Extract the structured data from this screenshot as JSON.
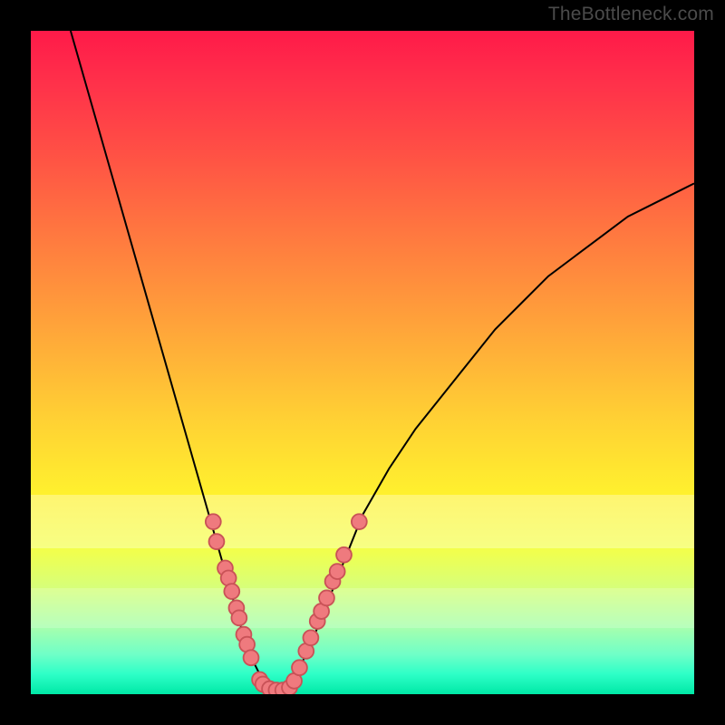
{
  "watermark": "TheBottleneck.com",
  "colors": {
    "frame_bg": "#000000",
    "curve": "#000000",
    "marker_fill": "#ef7a7e",
    "marker_stroke": "#c95257",
    "gradient_top": "#ff1a49",
    "gradient_bottom": "#00e8a6"
  },
  "chart_data": {
    "type": "line",
    "title": "",
    "xlabel": "",
    "ylabel": "",
    "xlim": [
      0,
      100
    ],
    "ylim": [
      0,
      100
    ],
    "grid": false,
    "legend": false,
    "series": [
      {
        "name": "bottleneck-curve",
        "x": [
          6,
          8,
          10,
          12,
          14,
          16,
          18,
          20,
          22,
          24,
          26,
          28,
          30,
          32,
          33,
          34,
          35,
          36,
          37,
          38,
          39,
          40,
          42,
          44,
          46,
          48,
          50,
          54,
          58,
          62,
          66,
          70,
          74,
          78,
          82,
          86,
          90,
          94,
          98,
          100
        ],
        "y": [
          100,
          93,
          86,
          79,
          72,
          65,
          58,
          51,
          44,
          37,
          30,
          23,
          16,
          9,
          6,
          4,
          2,
          1,
          0.5,
          0.5,
          1,
          3,
          7,
          12,
          17,
          22,
          27,
          34,
          40,
          45,
          50,
          55,
          59,
          63,
          66,
          69,
          72,
          74,
          76,
          77
        ]
      }
    ],
    "markers": {
      "name": "sample-points",
      "style": "circle",
      "points": [
        {
          "x": 27.5,
          "y": 26
        },
        {
          "x": 28.0,
          "y": 23
        },
        {
          "x": 29.3,
          "y": 19
        },
        {
          "x": 29.8,
          "y": 17.5
        },
        {
          "x": 30.3,
          "y": 15.5
        },
        {
          "x": 31.0,
          "y": 13
        },
        {
          "x": 31.4,
          "y": 11.5
        },
        {
          "x": 32.1,
          "y": 9
        },
        {
          "x": 32.6,
          "y": 7.5
        },
        {
          "x": 33.2,
          "y": 5.5
        },
        {
          "x": 34.5,
          "y": 2.2
        },
        {
          "x": 35.0,
          "y": 1.5
        },
        {
          "x": 36.0,
          "y": 0.8
        },
        {
          "x": 37.0,
          "y": 0.6
        },
        {
          "x": 38.0,
          "y": 0.6
        },
        {
          "x": 39.0,
          "y": 1.0
        },
        {
          "x": 39.7,
          "y": 2.0
        },
        {
          "x": 40.5,
          "y": 4.0
        },
        {
          "x": 41.5,
          "y": 6.5
        },
        {
          "x": 42.2,
          "y": 8.5
        },
        {
          "x": 43.2,
          "y": 11
        },
        {
          "x": 43.8,
          "y": 12.5
        },
        {
          "x": 44.6,
          "y": 14.5
        },
        {
          "x": 45.5,
          "y": 17
        },
        {
          "x": 46.2,
          "y": 18.5
        },
        {
          "x": 47.2,
          "y": 21
        },
        {
          "x": 49.5,
          "y": 26
        }
      ]
    },
    "bands": [
      {
        "name": "pale-band-upper",
        "y_from": 70,
        "y_to": 78,
        "alpha": 0.32
      },
      {
        "name": "pale-band-lower",
        "y_from": 84,
        "y_to": 90,
        "alpha": 0.2
      }
    ]
  }
}
